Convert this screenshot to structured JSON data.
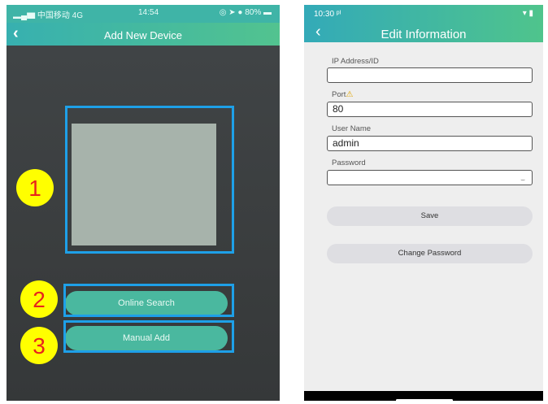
{
  "left": {
    "status": {
      "carrier": "▂▄▆ 中国移动 4G",
      "time": "14:54",
      "icons": "◎ ➤ ● 80% ▬"
    },
    "header": {
      "back": "‹",
      "title": "Add New Device"
    },
    "buttons": {
      "online_search": "Online Search",
      "manual_add": "Manual Add"
    },
    "badges": {
      "one": "1",
      "two": "2",
      "three": "3"
    },
    "colors": {
      "accent": "#1ea0e8",
      "button": "#4ab89f",
      "badge": "#ffff00",
      "badge_text": "#e8231c"
    }
  },
  "right": {
    "status": {
      "time": "10:30 ᵖᴵ",
      "sys": "▾ ▮"
    },
    "header": {
      "back": "‹",
      "title": "Edit Information"
    },
    "fields": {
      "ip": {
        "label": "IP Address/ID",
        "value": ""
      },
      "port": {
        "label": "Port",
        "warn": "⚠",
        "value": "80"
      },
      "user": {
        "label": "User Name",
        "value": "admin"
      },
      "password": {
        "label": "Password",
        "value": "",
        "eye": "⌣"
      }
    },
    "buttons": {
      "save": "Save",
      "change_password": "Change Password"
    }
  }
}
